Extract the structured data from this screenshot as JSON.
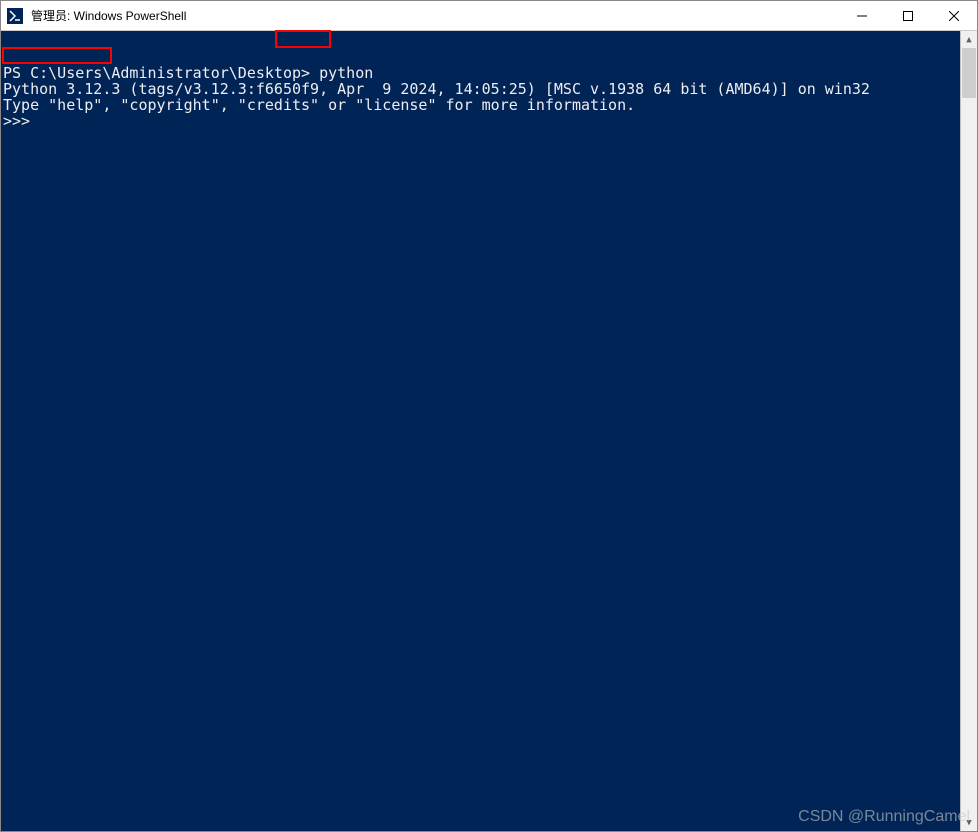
{
  "window": {
    "title": "管理员: Windows PowerShell"
  },
  "terminal": {
    "prompt_prefix": "PS C:\\Users\\Administrator\\Desktop> ",
    "command": "python",
    "python_version_prefix": "Python 3.12.3",
    "python_version_rest": " (tags/v3.12.3:f6650f9, Apr  9 2024, 14:05:25) [MSC v.1938 64 bit (AMD64)] on win32",
    "help_line": "Type \"help\", \"copyright\", \"credits\" or \"license\" for more information.",
    "repl_prompt": ">>>"
  },
  "watermark": "CSDN @RunningCamel"
}
